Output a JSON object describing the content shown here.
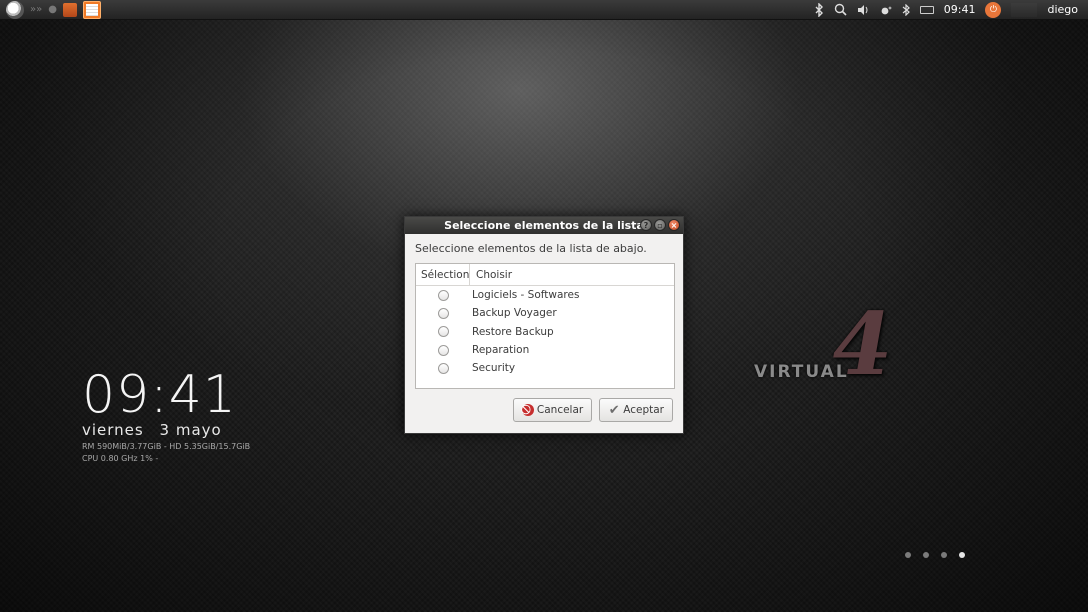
{
  "panel": {
    "clock": "09:41",
    "user": "diego",
    "left_icons": [
      "app-menu-icon",
      "forward-icon",
      "dot-icon",
      "file-manager-icon",
      "text-editor-icon"
    ],
    "right_icons": [
      "bluetooth-icon",
      "search-icon",
      "volume-icon",
      "recording-icon",
      "bluetooth-small-icon",
      "battery-icon",
      "session-icon"
    ]
  },
  "desktop": {
    "time": "09:41",
    "weekday": "viernes",
    "date": "3 mayo",
    "stats_line1": "RM 590MiB/3.77GiB - HD 5.35GiB/15.7GiB",
    "stats_line2": "CPU 0.80 GHz 1% -",
    "logo_number": "4",
    "logo_text": "VIRTUAL",
    "workspaces": 4,
    "active_workspace": 4
  },
  "dialog": {
    "title": "Seleccione elementos de la lista",
    "prompt": "Seleccione elementos de la lista de abajo.",
    "columns": [
      "Sélection",
      "Choisir"
    ],
    "items": [
      {
        "label": "Logiciels - Softwares",
        "selected": false
      },
      {
        "label": "Backup Voyager",
        "selected": false
      },
      {
        "label": "Restore Backup",
        "selected": false
      },
      {
        "label": "Reparation",
        "selected": false
      },
      {
        "label": "Security",
        "selected": false
      }
    ],
    "cancel_label": "Cancelar",
    "ok_label": "Aceptar"
  },
  "colors": {
    "accent": "#f07a27",
    "dialog_bg": "#f2f1f0",
    "titlebar": "#3a3a38",
    "close_button": "#d8582e"
  }
}
